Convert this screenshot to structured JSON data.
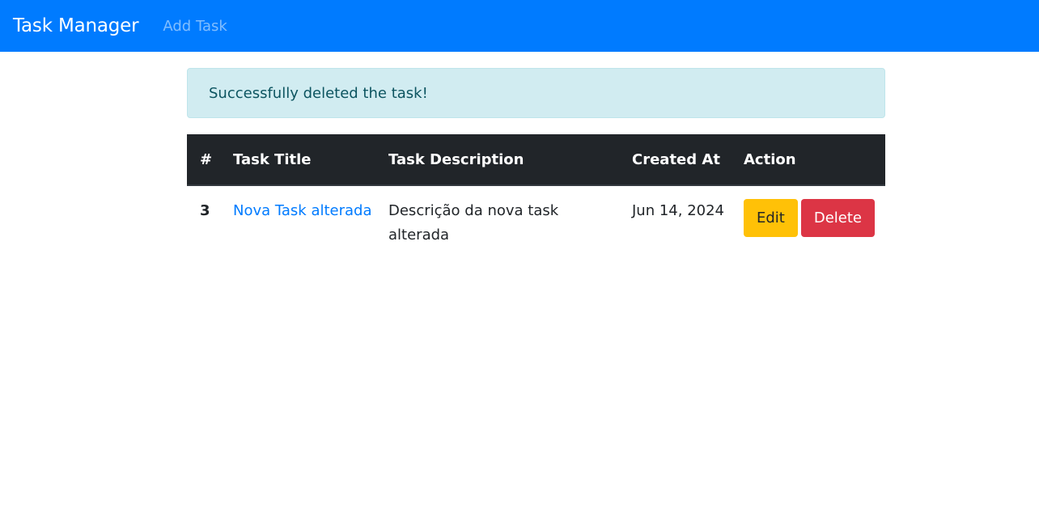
{
  "navbar": {
    "brand": "Task Manager",
    "links": [
      "Add Task"
    ],
    "bg_color": "#007bff"
  },
  "alert": {
    "message": "Successfully deleted the task!",
    "type": "info"
  },
  "table": {
    "headers": [
      "#",
      "Task Title",
      "Task Description",
      "Created At",
      "Action"
    ],
    "rows": [
      {
        "id": "3",
        "title": "Nova Task alterada",
        "description": "Descrição da nova task alterada",
        "created_at": "Jun 14, 2024",
        "edit_label": "Edit",
        "delete_label": "Delete"
      }
    ]
  },
  "colors": {
    "header_bg": "#212529",
    "link": "#007bff",
    "edit_btn": "#ffc107",
    "delete_btn": "#dc3545",
    "alert_bg": "#d1ecf1"
  }
}
